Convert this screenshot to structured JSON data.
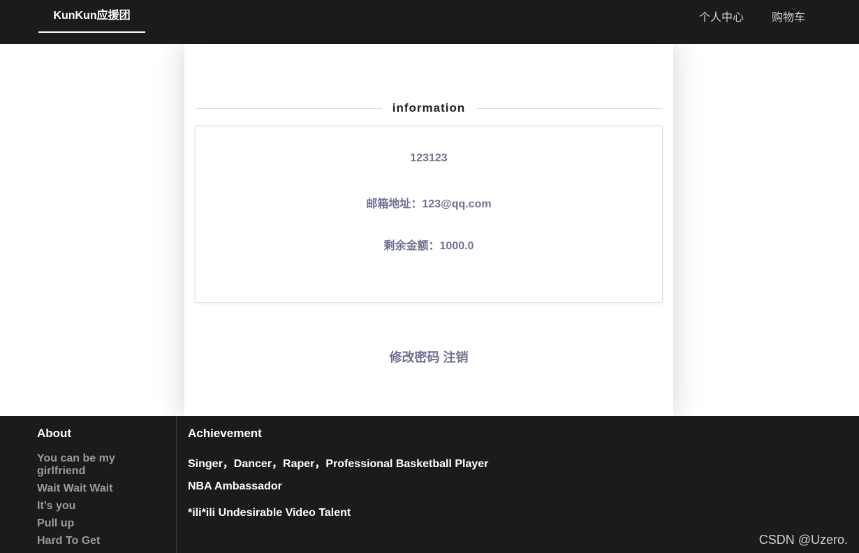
{
  "navbar": {
    "brand": "KunKun应援团",
    "links": [
      "个人中心",
      "购物车"
    ]
  },
  "card": {
    "section_title": "information",
    "username": "123123",
    "email_line": "邮箱地址：123@qq.com",
    "balance_line": "剩余金额：1000.0",
    "change_password": "修改密码",
    "logout": "注销"
  },
  "footer": {
    "about_title": "About",
    "about_items": [
      "You can be my girlfriend",
      "Wait Wait Wait",
      "It’s you",
      "Pull up",
      "Hard To Get"
    ],
    "achievement_title": "Achievement",
    "achievements": [
      "Singer，Dancer，Raper，Professional Basketball Player",
      "NBA Ambassador",
      "*ili*ili Undesirable Video Talent"
    ]
  },
  "watermark": "CSDN @Uzero."
}
